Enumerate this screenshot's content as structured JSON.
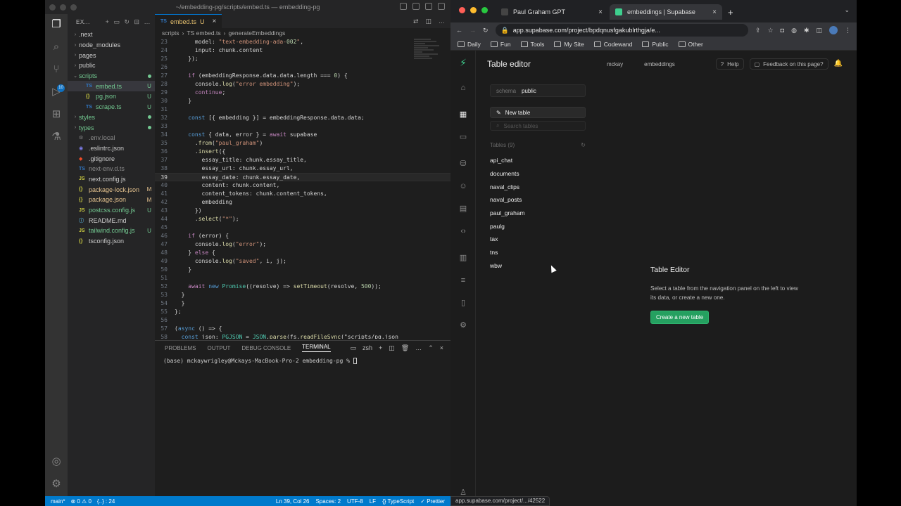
{
  "vscode": {
    "window_title": "~/embedding-pg/scripts/embed.ts — embedding-pg",
    "explorer_label": "EX...",
    "tree": [
      {
        "name": ".next",
        "type": "folder",
        "indent": 0,
        "status": "",
        "color": "#cccccc"
      },
      {
        "name": "node_modules",
        "type": "folder",
        "indent": 0,
        "status": "",
        "color": "#cccccc"
      },
      {
        "name": "pages",
        "type": "folder",
        "indent": 0,
        "status": "",
        "color": "#cccccc"
      },
      {
        "name": "public",
        "type": "folder",
        "indent": 0,
        "status": "",
        "color": "#cccccc"
      },
      {
        "name": "scripts",
        "type": "folder-open",
        "indent": 0,
        "status": "dot",
        "color": "#73c991"
      },
      {
        "name": "embed.ts",
        "type": "ts",
        "indent": 1,
        "status": "U",
        "color": "#73c991",
        "selected": true
      },
      {
        "name": "pg.json",
        "type": "json",
        "indent": 1,
        "status": "U",
        "color": "#73c991"
      },
      {
        "name": "scrape.ts",
        "type": "ts",
        "indent": 1,
        "status": "U",
        "color": "#73c991"
      },
      {
        "name": "styles",
        "type": "folder",
        "indent": 0,
        "status": "dot",
        "color": "#73c991"
      },
      {
        "name": "types",
        "type": "folder",
        "indent": 0,
        "status": "dot",
        "color": "#73c991"
      },
      {
        "name": ".env.local",
        "type": "env",
        "indent": 0,
        "status": "",
        "color": "#8c8c8c"
      },
      {
        "name": ".eslintrc.json",
        "type": "eslint",
        "indent": 0,
        "status": "",
        "color": "#cccccc"
      },
      {
        "name": ".gitignore",
        "type": "git",
        "indent": 0,
        "status": "",
        "color": "#cccccc"
      },
      {
        "name": "next-env.d.ts",
        "type": "ts",
        "indent": 0,
        "status": "",
        "color": "#8c8c8c"
      },
      {
        "name": "next.config.js",
        "type": "js",
        "indent": 0,
        "status": "",
        "color": "#cccccc"
      },
      {
        "name": "package-lock.json",
        "type": "json",
        "indent": 0,
        "status": "M",
        "color": "#e2c08d"
      },
      {
        "name": "package.json",
        "type": "json",
        "indent": 0,
        "status": "M",
        "color": "#e2c08d"
      },
      {
        "name": "postcss.config.js",
        "type": "js",
        "indent": 0,
        "status": "U",
        "color": "#73c991"
      },
      {
        "name": "README.md",
        "type": "md",
        "indent": 0,
        "status": "",
        "color": "#cccccc"
      },
      {
        "name": "tailwind.config.js",
        "type": "js",
        "indent": 0,
        "status": "U",
        "color": "#73c991"
      },
      {
        "name": "tsconfig.json",
        "type": "json",
        "indent": 0,
        "status": "",
        "color": "#cccccc"
      }
    ],
    "tab": {
      "icon": "TS",
      "label": "embed.ts",
      "status": "U"
    },
    "breadcrumb": [
      "scripts",
      "TS embed.ts",
      "generateEmbeddings"
    ],
    "code_start_line": 23,
    "current_line": 39,
    "code": [
      "      model: \"text-embedding-ada-002\",",
      "      input: chunk.content",
      "    });",
      "",
      "    if (embeddingResponse.data.data.length === 0) {",
      "      console.log(\"error embedding\");",
      "      continue;",
      "    }",
      "",
      "    const [{ embedding }] = embeddingResponse.data.data;",
      "",
      "    const { data, error } = await supabase",
      "      .from(\"paul_graham\")",
      "      .insert({",
      "        essay_title: chunk.essay_title,",
      "        essay_url: chunk.essay_url,",
      "        essay_date: chunk.essay_date,",
      "        content: chunk.content,",
      "        content_tokens: chunk.content_tokens,",
      "        embedding",
      "      })",
      "      .select(\"*\");",
      "",
      "    if (error) {",
      "      console.log(\"error\");",
      "    } else {",
      "      console.log(\"saved\", i, j);",
      "    }",
      "",
      "    await new Promise((resolve) => setTimeout(resolve, 500));",
      "  }",
      "  }",
      "};",
      "",
      "(async () => {",
      "  const json: PGJSON = JSON.parse(fs.readFileSync(\"scripts/pg.json"
    ],
    "panel_tabs": [
      "PROBLEMS",
      "OUTPUT",
      "DEBUG CONSOLE",
      "TERMINAL"
    ],
    "active_panel_tab": "TERMINAL",
    "shell": "zsh",
    "terminal_prompt": "(base) mckaywrigley@Mckays-MacBook-Pro-2 embedding-pg % ",
    "status_left": [
      "main*",
      "⊗ 0 ⚠ 0",
      "{..} : 24"
    ],
    "status_right": [
      "Ln 39, Col 26",
      "Spaces: 2",
      "UTF-8",
      "LF",
      "{} TypeScript",
      "✓ Prettier"
    ]
  },
  "browser": {
    "tabs": [
      {
        "title": "Paul Graham GPT",
        "active": false,
        "favicon_color": "#444444"
      },
      {
        "title": "embeddings | Supabase",
        "active": true,
        "favicon_color": "#3ecf8e"
      }
    ],
    "url": "app.supabase.com/project/bpdqnusfgakublrthgja/e...",
    "bookmarks": [
      "Daily",
      "Fun",
      "Tools",
      "My Site",
      "Codewand",
      "Public",
      "Other"
    ],
    "status_url": "app.supabase.com/project/.../42522"
  },
  "supabase": {
    "page_title": "Table editor",
    "crumb_org": "mckay",
    "crumb_project": "embeddings",
    "help_label": "Help",
    "feedback_label": "Feedback on this page?",
    "schema_label": "schema",
    "schema_value": "public",
    "new_table_label": "New table",
    "search_placeholder": "Search tables",
    "tables_header": "Tables (9)",
    "tables": [
      "api_chat",
      "documents",
      "naval_clips",
      "naval_posts",
      "paul_graham",
      "paulg",
      "tax",
      "tns",
      "wbw"
    ],
    "card_title": "Table Editor",
    "card_text": "Select a table from the navigation panel on the left to view its data, or create a new one.",
    "create_button": "Create a new table",
    "accent": "#3ecf8e"
  }
}
